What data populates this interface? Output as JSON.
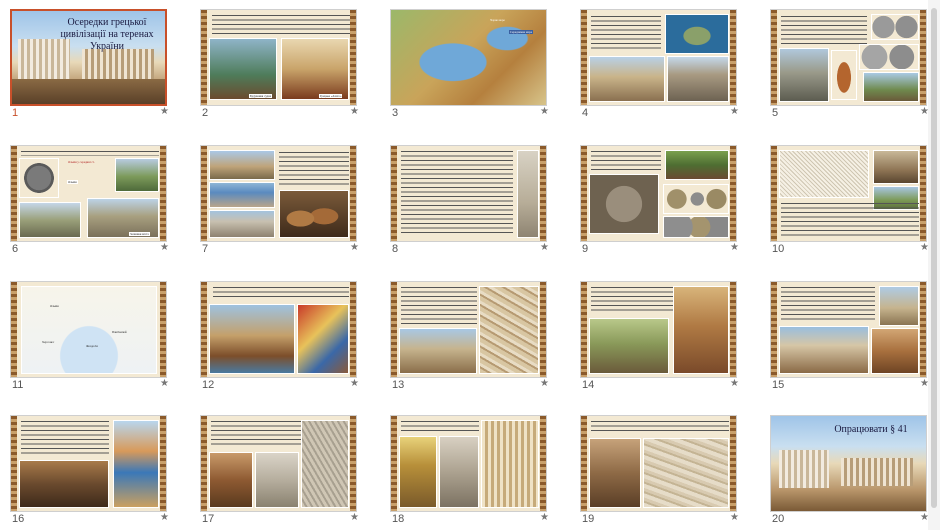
{
  "app": {
    "view": "slide-sorter"
  },
  "slides": [
    {
      "number": "1",
      "title": "Осередки грецької цивілізації на теренах України",
      "selected": true
    },
    {
      "number": "2",
      "captions": [
        "Будування судна",
        "Грецьке «Ахато»"
      ]
    },
    {
      "number": "3",
      "captions": [
        "Чорне море",
        "Середземне море"
      ]
    },
    {
      "number": "4"
    },
    {
      "number": "5"
    },
    {
      "number": "6",
      "captions": [
        "Ольвія",
        "Ольвія у середині ст.",
        "Залишки міста"
      ]
    },
    {
      "number": "7"
    },
    {
      "number": "8"
    },
    {
      "number": "9"
    },
    {
      "number": "10"
    },
    {
      "number": "11",
      "captions": [
        "Ольвія",
        "Херсонес",
        "Пантікапей",
        "Феодосія"
      ]
    },
    {
      "number": "12"
    },
    {
      "number": "13"
    },
    {
      "number": "14"
    },
    {
      "number": "15"
    },
    {
      "number": "16"
    },
    {
      "number": "17"
    },
    {
      "number": "18"
    },
    {
      "number": "19"
    },
    {
      "number": "20",
      "title": "Опрацювати § 41"
    }
  ],
  "icons": {
    "transition": "star-icon"
  }
}
